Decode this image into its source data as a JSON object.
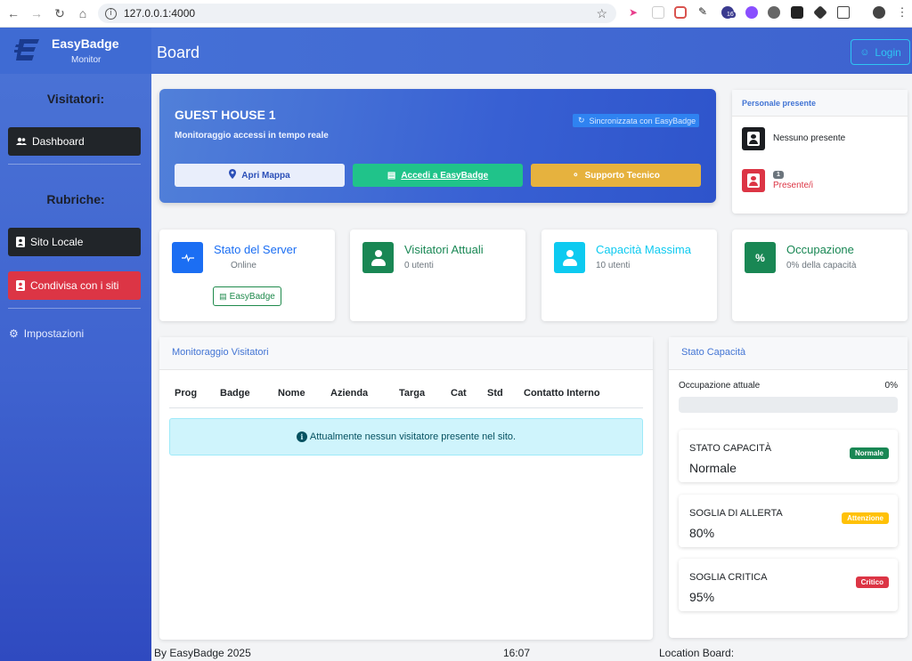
{
  "browser": {
    "url": "127.0.0.1:4000",
    "ext_badge": "16"
  },
  "brand": {
    "name": "EasyBadge",
    "subtitle": "Monitor"
  },
  "sidebar": {
    "visitors_heading": "Visitatori:",
    "dashboard_label": "Dashboard",
    "contacts_heading": "Rubriche:",
    "local_site_label": "Sito Locale",
    "shared_label": "Condivisa con i siti",
    "settings_label": "Impostazioni"
  },
  "header": {
    "title": "Board",
    "login_label": "Login"
  },
  "hero": {
    "title": "GUEST HOUSE 1",
    "subtitle": "Monitoraggio accessi in tempo reale",
    "sync_label": "Sincronizzata con EasyBadge",
    "map_button": "Apri Mappa",
    "access_button": "Accedi a EasyBadge",
    "support_button": "Supporto Tecnico"
  },
  "staff": {
    "title": "Personale presente",
    "none_label": "Nessuno presente",
    "count": "1",
    "present_label": "Presente/i"
  },
  "cards": {
    "server": {
      "title": "Stato del Server",
      "status": "Online",
      "button": "EasyBadge"
    },
    "visitors": {
      "title": "Visitatori Attuali",
      "value": "0 utenti"
    },
    "capacity": {
      "title": "Capacità Massima",
      "value": "10 utenti"
    },
    "occupancy": {
      "title": "Occupazione",
      "value": "0% della capacità",
      "icon_text": "%"
    }
  },
  "monitor": {
    "title": "Monitoraggio Visitatori",
    "columns": [
      "Prog",
      "Badge",
      "Nome",
      "Azienda",
      "Targa",
      "Cat",
      "Std",
      "Contatto Interno"
    ],
    "empty_message": "Attualmente nessun visitatore presente nel sito."
  },
  "capacity_panel": {
    "title": "Stato Capacità",
    "current_label": "Occupazione attuale",
    "current_value": "0%",
    "current_fraction": 0,
    "status": {
      "label": "STATO CAPACITÀ",
      "value": "Normale",
      "badge": "Normale"
    },
    "alert": {
      "label": "SOGLIA DI ALLERTA",
      "value": "80%",
      "badge": "Attenzione"
    },
    "critical": {
      "label": "SOGLIA CRITICA",
      "value": "95%",
      "badge": "Critico"
    }
  },
  "footer": {
    "left": "By EasyBadge 2025",
    "time": "16:07",
    "location_label": "Location Board:"
  },
  "colors": {
    "primary": "#3f63cf",
    "success": "#198754",
    "warning": "#ffc107",
    "danger": "#dc3545",
    "info": "#0dcaf0",
    "dark": "#212529"
  }
}
